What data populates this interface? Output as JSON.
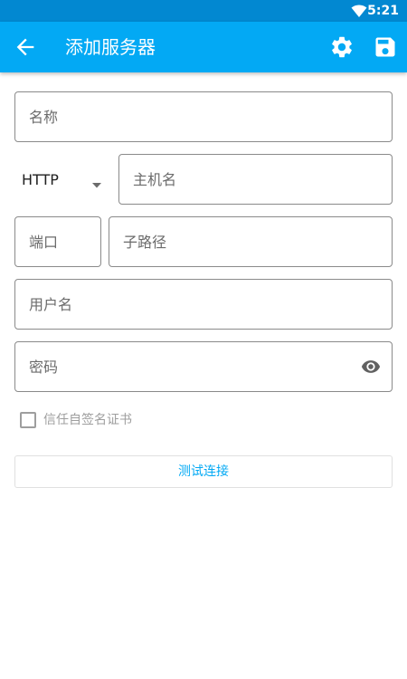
{
  "status_bar": {
    "time": "5:21",
    "wifi_icon": "wifi-icon"
  },
  "app_bar": {
    "title": "添加服务器",
    "back_icon": "arrow-back-icon",
    "settings_icon": "gear-icon",
    "save_icon": "save-icon",
    "background_color": "#03a9f4",
    "status_bar_color": "#0288d1"
  },
  "form": {
    "name_placeholder": "名称",
    "protocol_value": "HTTP",
    "host_placeholder": "主机名",
    "port_placeholder": "端口",
    "subpath_placeholder": "子路径",
    "username_placeholder": "用户名",
    "password_placeholder": "密码",
    "password_visibility_icon": "eye-icon",
    "trust_self_signed_label": "信任自签名证书",
    "trust_self_signed_checked": false
  },
  "test_button": {
    "label": "测试连接",
    "color": "#03a9f4"
  }
}
